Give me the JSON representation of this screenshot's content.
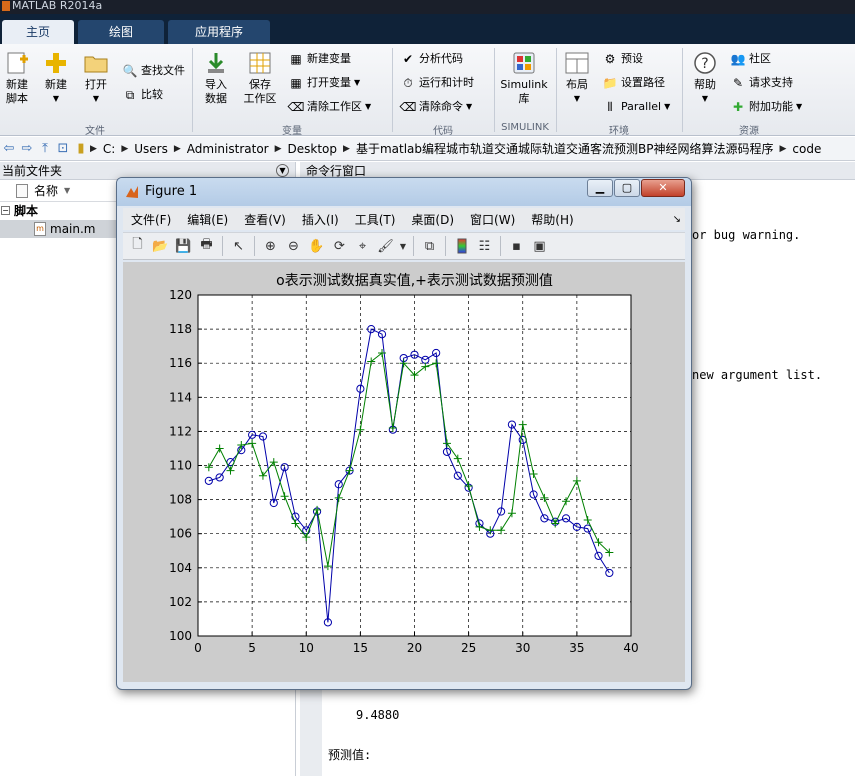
{
  "app": {
    "title": "MATLAB R2014a"
  },
  "tabs": [
    {
      "label": "主页"
    },
    {
      "label": "绘图"
    },
    {
      "label": "应用程序"
    }
  ],
  "ribbon": {
    "new_script": "新建\n脚本",
    "new": "新建",
    "open": "打开",
    "find_files": "查找文件",
    "compare": "比较",
    "import_data": "导入\n数据",
    "save_workspace": "保存\n工作区",
    "new_variable": "新建变量",
    "open_variable": "打开变量",
    "clear_workspace": "清除工作区",
    "analyze_code": "分析代码",
    "run_and_time": "运行和计时",
    "clear_commands": "清除命令",
    "simulink": "Simulink\n库",
    "layout": "布局",
    "preferences": "预设",
    "set_path": "设置路径",
    "parallel": "Parallel",
    "help": "帮助",
    "community": "社区",
    "request_support": "请求支持",
    "addons": "附加功能",
    "sections": {
      "file": "文件",
      "variable": "变量",
      "code": "代码",
      "simulink": "SIMULINK",
      "environment": "环境",
      "resources": "资源"
    }
  },
  "address": {
    "crumbs": [
      "C:",
      "Users",
      "Administrator",
      "Desktop",
      "基于matlab编程城市轨道交通城际轨道交通客流预测BP神经网络算法源码程序",
      "code"
    ]
  },
  "left_panel": {
    "title": "当前文件夹",
    "column_name": "名称",
    "group": "脚本",
    "file": "main.m"
  },
  "command_window": {
    "title": "命令行窗口",
    "line1": "or bug warning.",
    "line2": "new argument list.",
    "value": "9.4880",
    "label": "预测值:"
  },
  "figure": {
    "title": "Figure 1",
    "menu": [
      "文件(F)",
      "编辑(E)",
      "查看(V)",
      "插入(I)",
      "工具(T)",
      "桌面(D)",
      "窗口(W)",
      "帮助(H)"
    ]
  },
  "colors": {
    "actual": "#0000aa",
    "predicted": "#008000"
  },
  "chart_data": {
    "type": "line",
    "title": "o表示测试数据真实值,+表示测试数据预测值",
    "xlabel": "",
    "ylabel": "",
    "xlim": [
      0,
      40
    ],
    "ylim": [
      100,
      120
    ],
    "xticks": [
      0,
      5,
      10,
      15,
      20,
      25,
      30,
      35,
      40
    ],
    "yticks": [
      100,
      102,
      104,
      106,
      108,
      110,
      112,
      114,
      116,
      118,
      120
    ],
    "grid": true,
    "x": [
      1,
      2,
      3,
      4,
      5,
      6,
      7,
      8,
      9,
      10,
      11,
      12,
      13,
      14,
      15,
      16,
      17,
      18,
      19,
      20,
      21,
      22,
      23,
      24,
      25,
      26,
      27,
      28,
      29,
      30,
      31,
      32,
      33,
      34,
      35,
      36,
      37,
      38
    ],
    "series": [
      {
        "marker": "o",
        "color": "#0000aa",
        "values": [
          109.1,
          109.3,
          110.2,
          110.9,
          111.8,
          111.7,
          107.8,
          109.9,
          107.0,
          106.2,
          107.3,
          100.8,
          108.9,
          109.7,
          114.5,
          118.0,
          117.7,
          112.1,
          116.3,
          116.5,
          116.2,
          116.6,
          110.8,
          109.4,
          108.7,
          106.6,
          106.0,
          107.3,
          112.4,
          111.5,
          108.3,
          106.9,
          106.7,
          106.9,
          106.4,
          106.3,
          104.7,
          103.7
        ]
      },
      {
        "marker": "+",
        "color": "#008000",
        "values": [
          109.9,
          111.0,
          109.7,
          111.2,
          111.3,
          109.4,
          110.2,
          108.2,
          106.6,
          105.8,
          107.4,
          104.1,
          108.1,
          109.7,
          112.1,
          116.1,
          116.6,
          112.2,
          116.0,
          115.3,
          115.8,
          116.0,
          111.3,
          110.4,
          108.8,
          106.4,
          106.2,
          106.2,
          107.2,
          112.4,
          109.5,
          108.1,
          106.6,
          107.9,
          109.1,
          106.8,
          105.5,
          104.9
        ]
      }
    ]
  }
}
